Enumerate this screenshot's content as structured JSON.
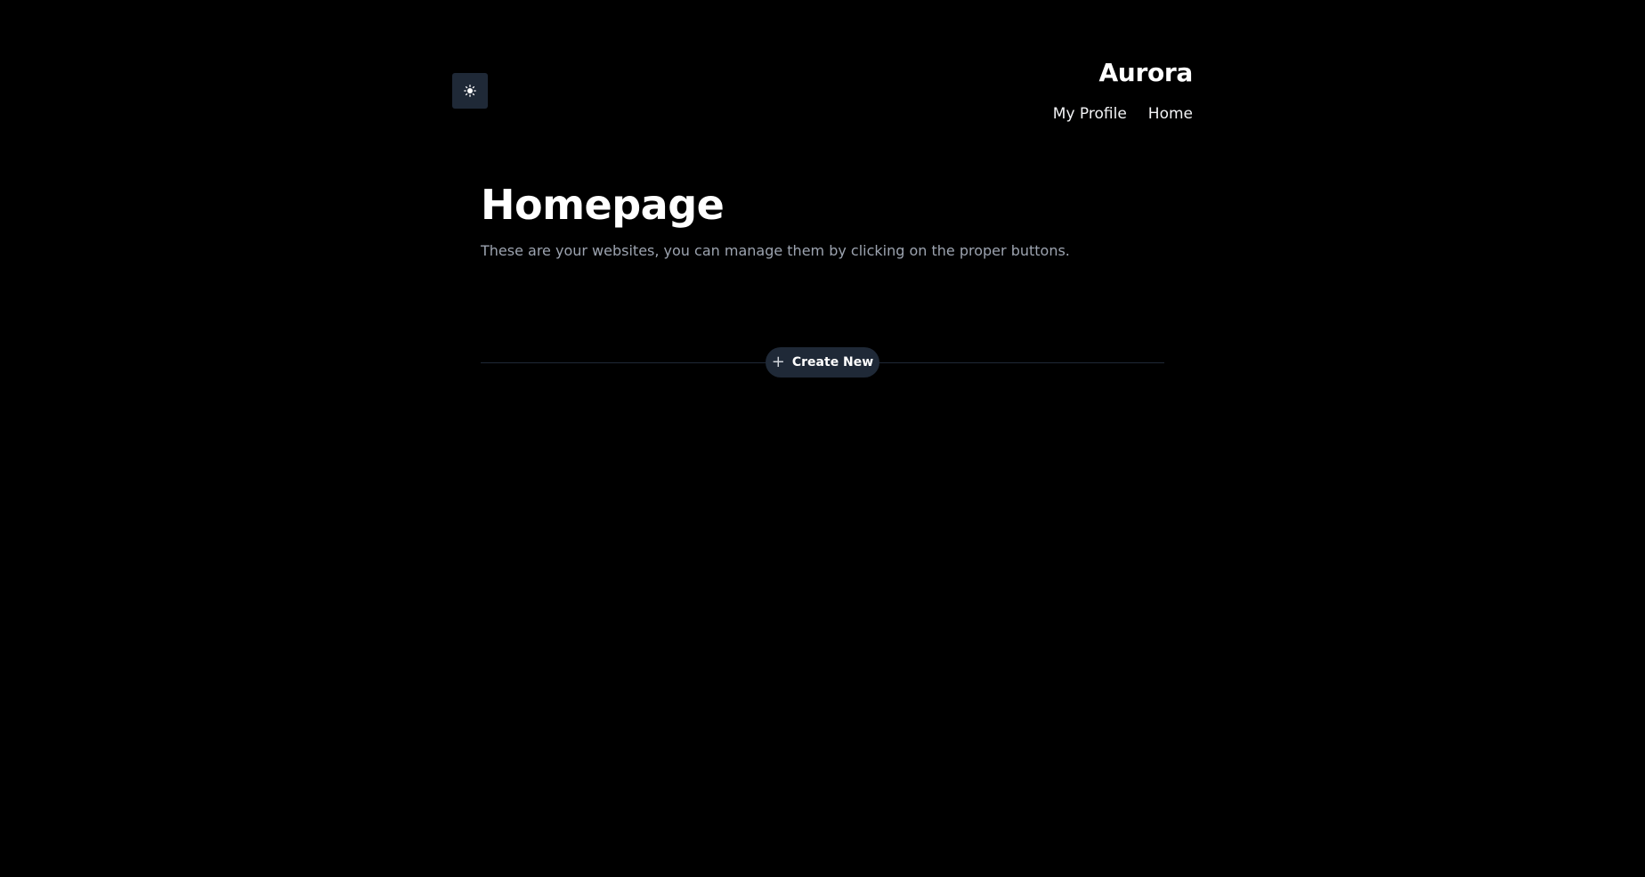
{
  "header": {
    "theme_toggle_icon": "sun-icon",
    "brand": "Aurora",
    "nav": [
      {
        "label": "My Profile"
      },
      {
        "label": "Home"
      }
    ]
  },
  "main": {
    "title": "Homepage",
    "subtitle": "These are your websites, you can manage them by clicking on the proper buttons.",
    "create_button": {
      "icon": "plus-icon",
      "label": "Create New"
    }
  },
  "colors": {
    "background": "#000000",
    "surface": "#1f2937",
    "muted_text": "#9ca3af",
    "text": "#ffffff"
  }
}
